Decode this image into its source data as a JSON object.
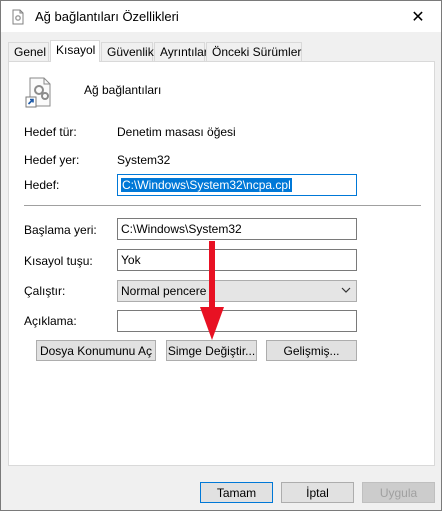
{
  "window": {
    "title": "Ağ bağlantıları Özellikleri",
    "close_glyph": "✕"
  },
  "tabs": [
    {
      "label": "Genel"
    },
    {
      "label": "Kısayol"
    },
    {
      "label": "Güvenlik"
    },
    {
      "label": "Ayrıntılar"
    },
    {
      "label": "Önceki Sürümler"
    }
  ],
  "header": {
    "name": "Ağ bağlantıları",
    "icon": "control-panel-shortcut-icon"
  },
  "info": {
    "target_type_label": "Hedef tür:",
    "target_type_value": "Denetim masası öğesi",
    "target_location_label": "Hedef yer:",
    "target_location_value": "System32",
    "target_label": "Hedef:",
    "target_value": "C:\\Windows\\System32\\ncpa.cpl"
  },
  "fields": {
    "start_in_label": "Başlama yeri:",
    "start_in_value": "C:\\Windows\\System32",
    "shortcut_key_label": "Kısayol tuşu:",
    "shortcut_key_value": "Yok",
    "run_label": "Çalıştır:",
    "run_value": "Normal pencere",
    "comment_label": "Açıklama:",
    "comment_value": ""
  },
  "buttons": {
    "open_location": "Dosya Konumunu Aç",
    "change_icon": "Simge Değiştir...",
    "advanced": "Gelişmiş...",
    "ok": "Tamam",
    "cancel": "İptal",
    "apply": "Uygula"
  },
  "colors": {
    "accent": "#0078d7",
    "arrow": "#e81123"
  }
}
